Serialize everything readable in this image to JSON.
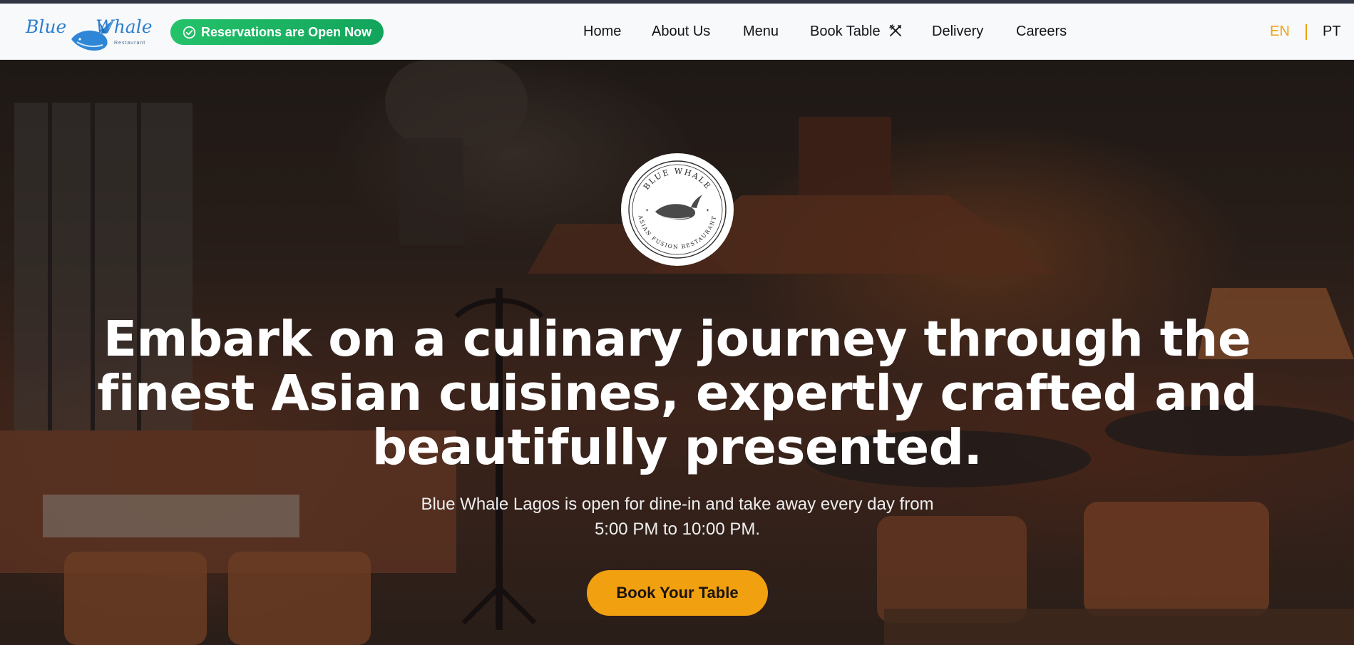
{
  "header": {
    "logo": {
      "name": "Blue Whale",
      "word1": "Blue",
      "word2": "Whale",
      "subtitle": "Restaurant"
    },
    "reservation_status": "Reservations are Open Now",
    "nav": {
      "home": "Home",
      "about": "About Us",
      "menu": "Menu",
      "book_table": "Book Table",
      "delivery": "Delivery",
      "careers": "Careers"
    },
    "languages": {
      "active": "EN",
      "other": "PT"
    }
  },
  "hero": {
    "badge": {
      "top_text": "BLUE WHALE",
      "bottom_text": "ASIAN FUSION RESTAURANT"
    },
    "headline": "Embark on a culinary journey through the finest Asian cuisines, expertly crafted and beautifully presented.",
    "subtext_line1": "Blue Whale Lagos is open for dine-in and take away every day from",
    "subtext_line2": "5:00 PM to 10:00 PM.",
    "cta": "Book Your Table"
  },
  "icons": {
    "reservation": "check-circle-icon",
    "book_table": "utensils-icon",
    "badge": "whale-icon"
  },
  "colors": {
    "accent": "#f1a010",
    "status_green": "#1db463",
    "brand_blue": "#2d7fd0",
    "active_language": "#f0a20f"
  }
}
